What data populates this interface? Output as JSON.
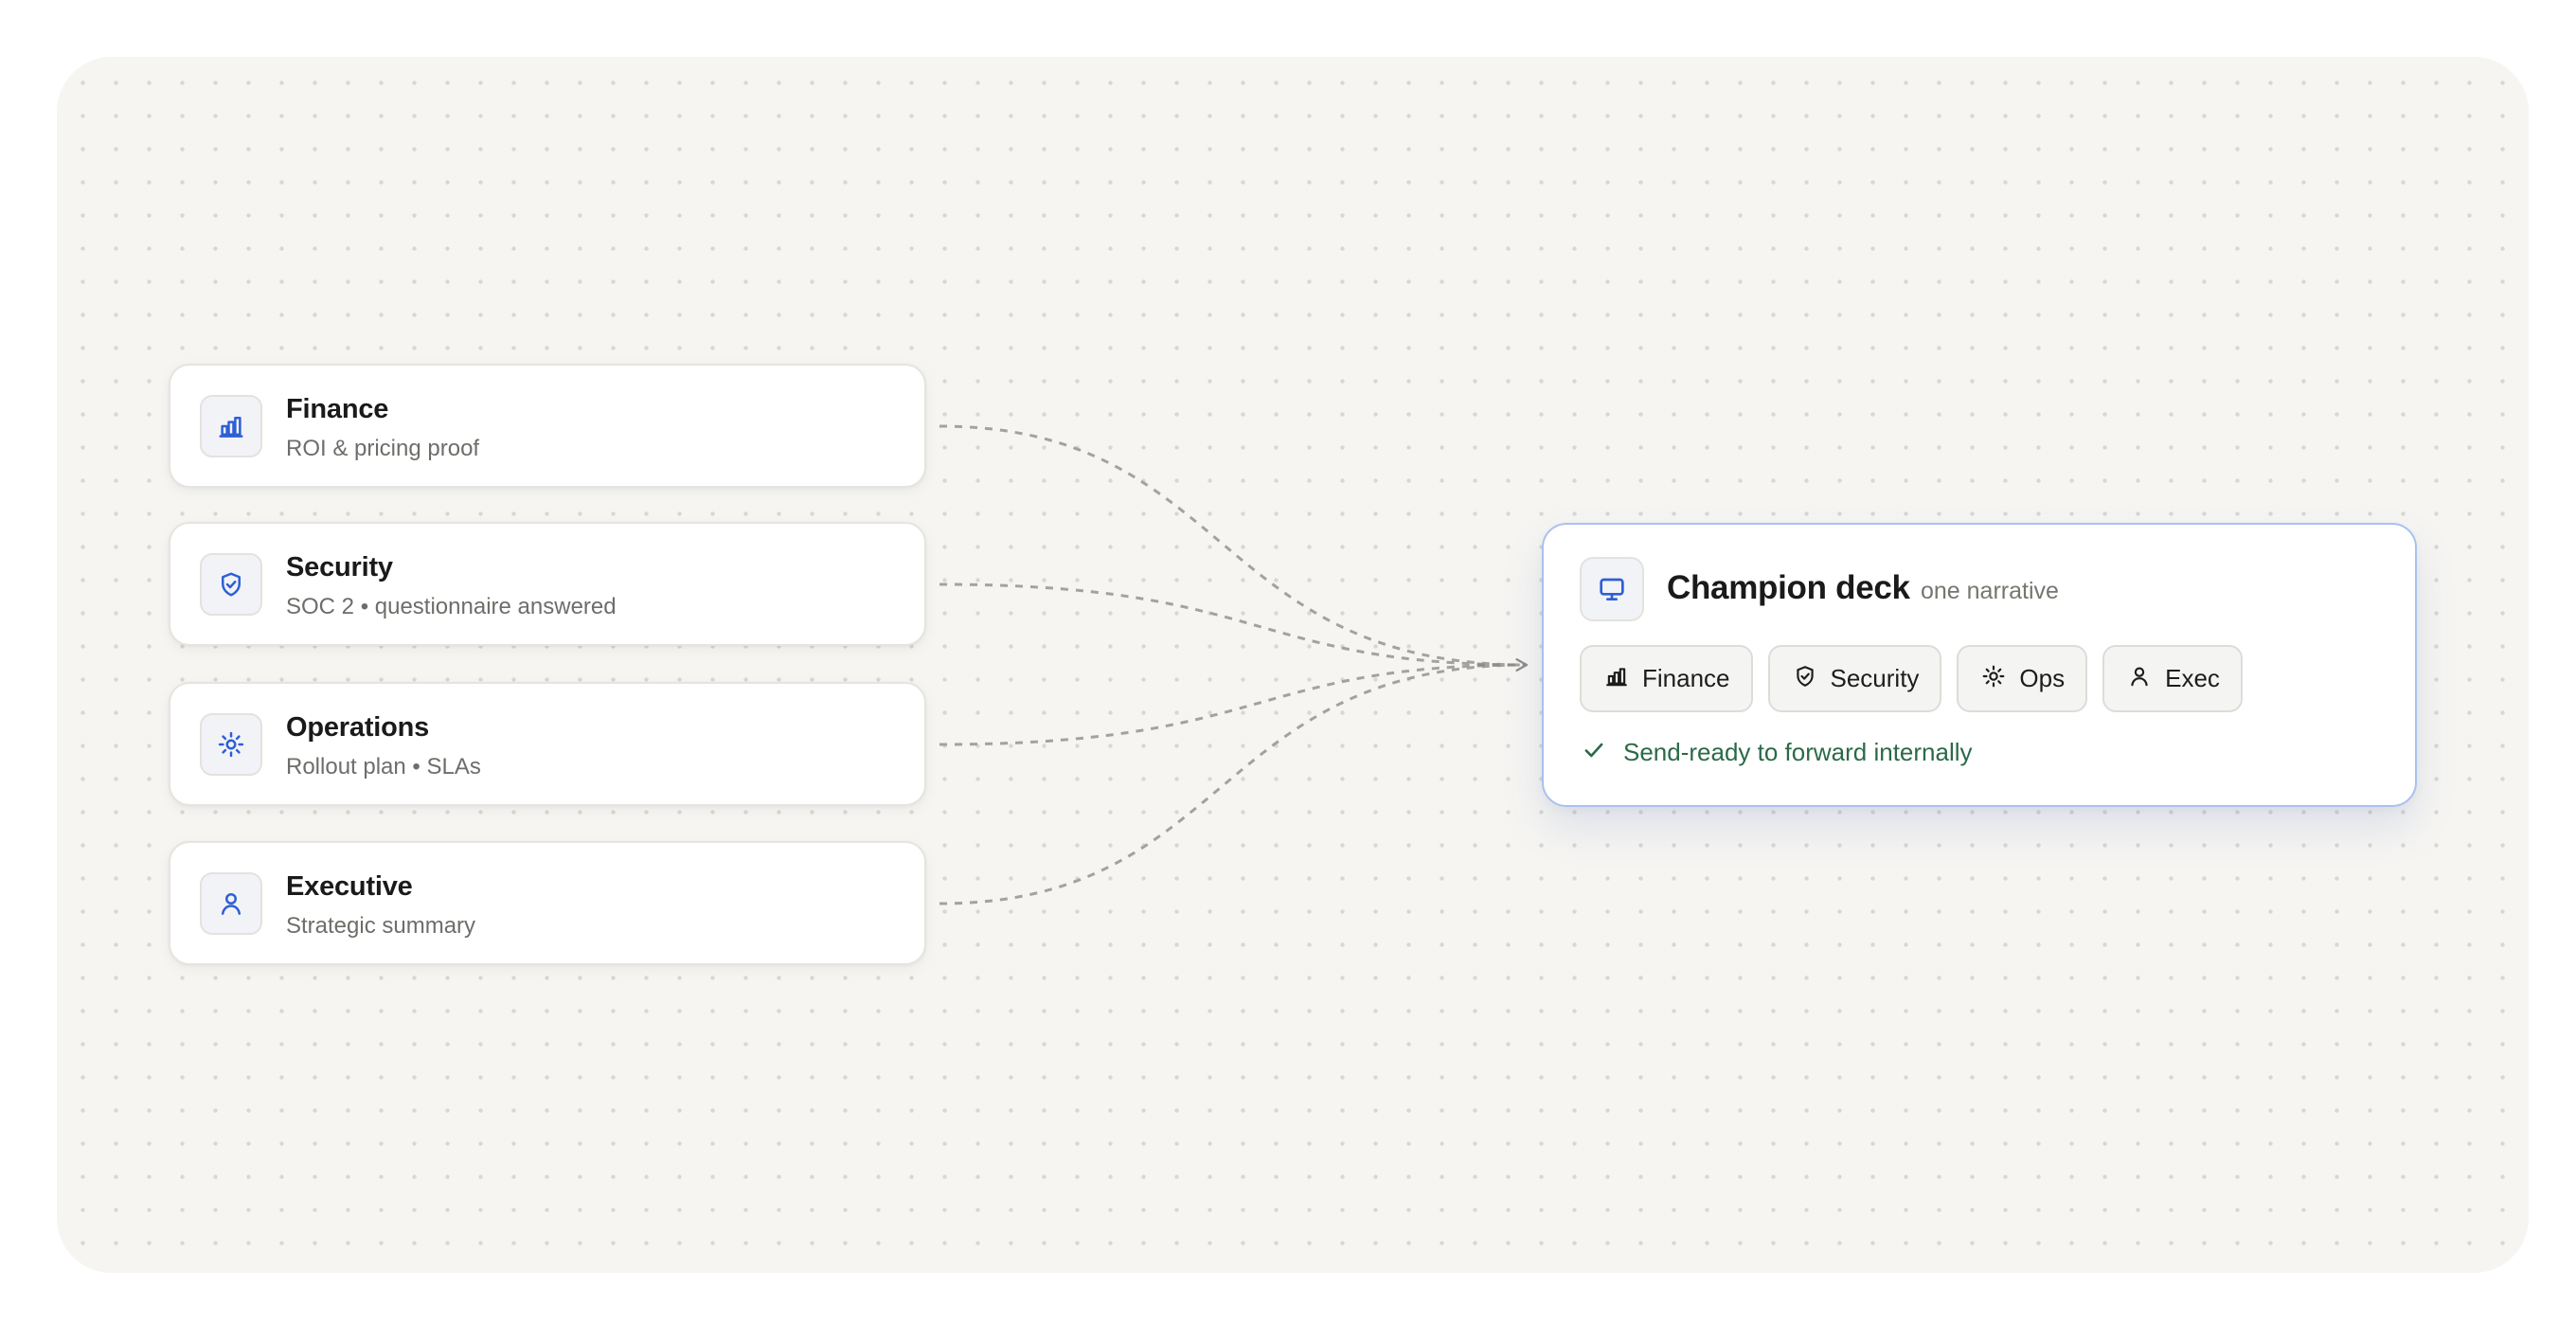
{
  "sources": [
    {
      "title": "Finance",
      "subtitle": "ROI & pricing proof",
      "icon": "bar-chart-icon"
    },
    {
      "title": "Security",
      "subtitle": "SOC 2 • questionnaire answered",
      "icon": "shield-check-icon"
    },
    {
      "title": "Operations",
      "subtitle": "Rollout plan • SLAs",
      "icon": "gear-icon"
    },
    {
      "title": "Executive",
      "subtitle": "Strategic summary",
      "icon": "person-icon"
    }
  ],
  "deck": {
    "title": "Champion deck",
    "subtitle": "one narrative",
    "icon": "monitor-icon",
    "chips": [
      {
        "label": "Finance",
        "icon": "bar-chart-icon"
      },
      {
        "label": "Security",
        "icon": "shield-check-icon"
      },
      {
        "label": "Ops",
        "icon": "gear-icon"
      },
      {
        "label": "Exec",
        "icon": "person-icon"
      }
    ],
    "status": "Send-ready to forward internally",
    "status_icon": "check-icon"
  },
  "colors": {
    "accent": "#2d5fd6",
    "deck_border": "#a9c1ef",
    "status": "#2b6a47",
    "connector": "#a3a29e",
    "canvas": "#f6f5f2"
  }
}
